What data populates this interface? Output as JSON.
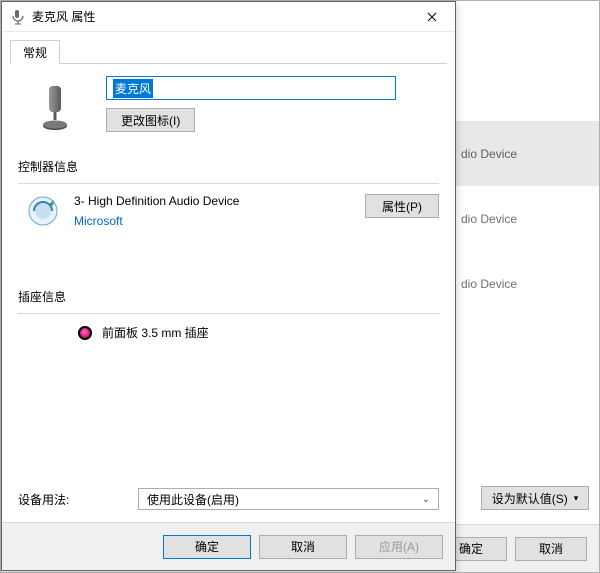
{
  "bg": {
    "items": [
      "dio Device",
      "dio Device",
      "dio Device"
    ],
    "set_default_label": "设为默认值(S)",
    "ok_label": "确定",
    "cancel_label": "取消"
  },
  "dialog": {
    "title": "麦克风 属性",
    "tab_general": "常规",
    "device_name": "麦克风",
    "change_icon_label": "更改图标(I)",
    "controller_section": "控制器信息",
    "controller_name": "3- High Definition Audio Device",
    "controller_manufacturer": "Microsoft",
    "controller_props_label": "属性(P)",
    "jack_section": "插座信息",
    "jack_label": "前面板 3.5 mm 插座",
    "usage_label": "设备用法:",
    "usage_value": "使用此设备(启用)",
    "ok_label": "确定",
    "cancel_label": "取消",
    "apply_label": "应用(A)"
  }
}
